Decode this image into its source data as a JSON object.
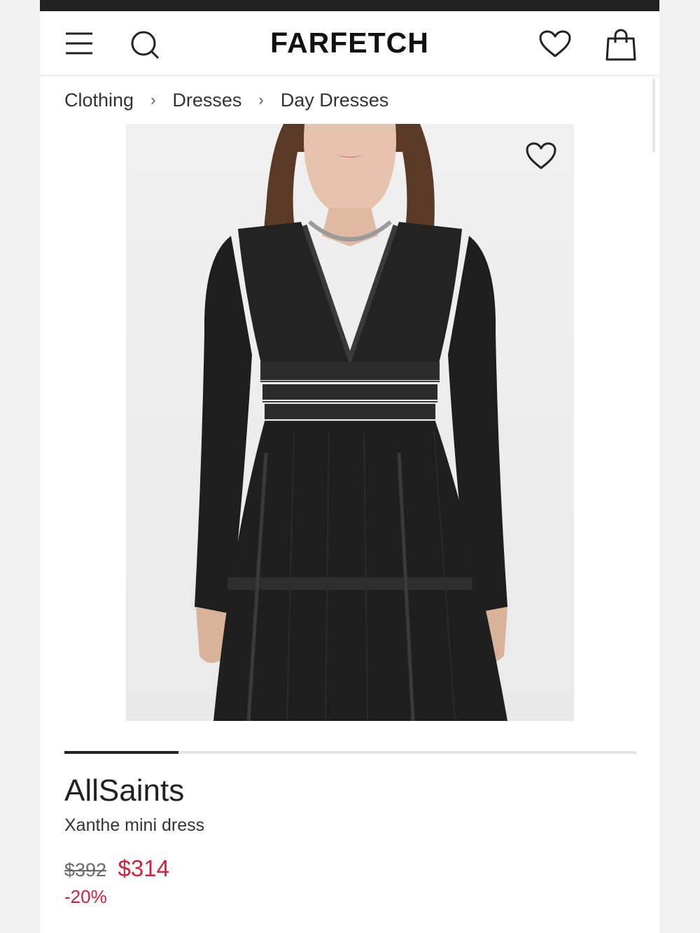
{
  "header": {
    "logo": "FARFETCH",
    "icons": {
      "menu": "menu-icon",
      "search": "search-icon",
      "wishlist": "heart-icon",
      "bag": "shopping-bag-icon"
    }
  },
  "breadcrumb": [
    "Clothing",
    "Dresses",
    "Day Dresses"
  ],
  "product": {
    "image_alt_icon": "heart-icon",
    "brand": "AllSaints",
    "name": "Xanthe mini dress",
    "price_original": "$392",
    "price_sale": "$314",
    "discount": "-20%"
  },
  "carousel": {
    "current": 1,
    "total": 5
  },
  "colors": {
    "sale": "#d6203a",
    "text": "#222222",
    "divider": "#e5e5e5"
  }
}
